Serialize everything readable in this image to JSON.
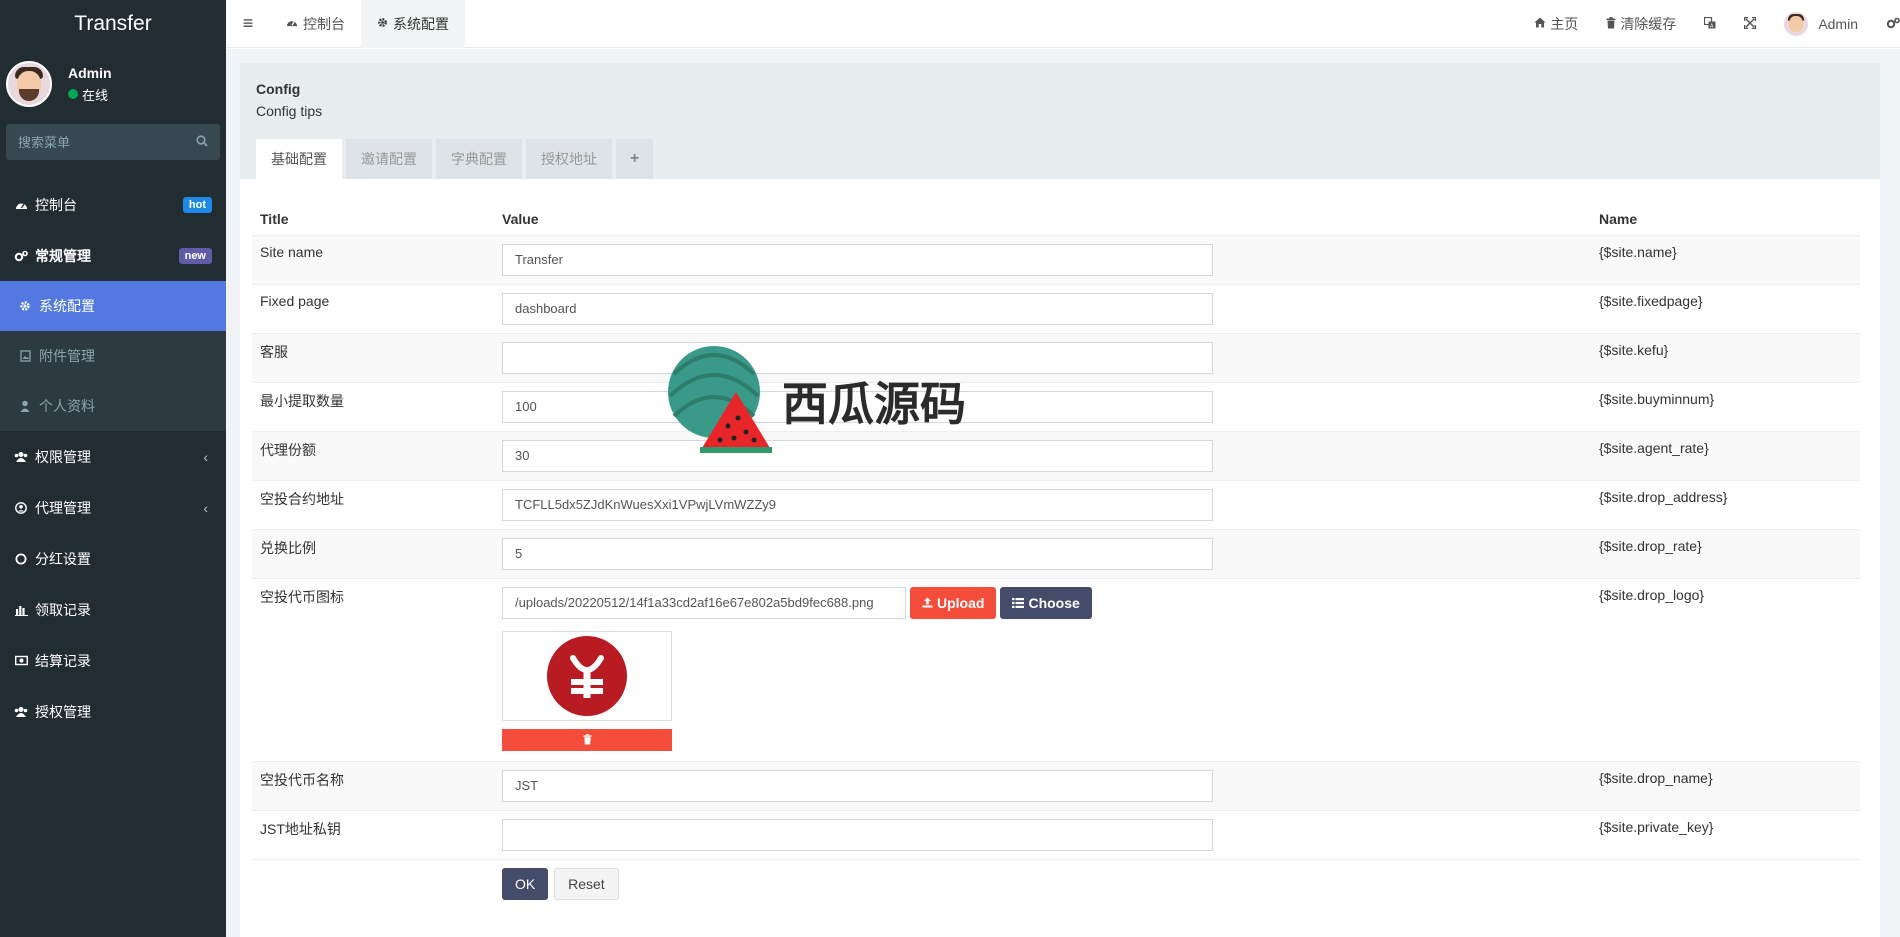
{
  "brand": "Transfer",
  "user": {
    "name": "Admin",
    "status": "在线"
  },
  "search": {
    "placeholder": "搜索菜单"
  },
  "sidebar": {
    "items": [
      {
        "label": "控制台",
        "icon": "dashboard-icon",
        "badge": "hot"
      },
      {
        "label": "常规管理",
        "icon": "cogs-icon",
        "badge": "new"
      },
      {
        "label": "系统配置",
        "icon": "gear-icon"
      },
      {
        "label": "附件管理",
        "icon": "file-image-icon"
      },
      {
        "label": "个人资料",
        "icon": "user-icon"
      },
      {
        "label": "权限管理",
        "icon": "group-icon"
      },
      {
        "label": "代理管理",
        "icon": "user-circle-icon"
      },
      {
        "label": "分红设置",
        "icon": "circle-icon"
      },
      {
        "label": "领取记录",
        "icon": "chart-icon"
      },
      {
        "label": "结算记录",
        "icon": "money-icon"
      },
      {
        "label": "授权管理",
        "icon": "group-icon"
      }
    ]
  },
  "header": {
    "tabs": [
      {
        "label": "控制台",
        "icon": "dashboard-icon"
      },
      {
        "label": "系统配置",
        "icon": "gear-icon"
      }
    ],
    "home": "主页",
    "clear_cache": "清除缓存",
    "user": "Admin"
  },
  "panel": {
    "title": "Config",
    "tips": "Config tips",
    "tabs": [
      "基础配置",
      "邀请配置",
      "字典配置",
      "授权地址"
    ]
  },
  "table": {
    "headers": {
      "title": "Title",
      "value": "Value",
      "name": "Name"
    },
    "rows": [
      {
        "title": "Site name",
        "value": "Transfer",
        "name": "{$site.name}"
      },
      {
        "title": "Fixed page",
        "value": "dashboard",
        "name": "{$site.fixedpage}"
      },
      {
        "title": "客服",
        "value": "",
        "name": "{$site.kefu}"
      },
      {
        "title": "最小提取数量",
        "value": "100",
        "name": "{$site.buyminnum}"
      },
      {
        "title": "代理份额",
        "value": "30",
        "name": "{$site.agent_rate}"
      },
      {
        "title": "空投合约地址",
        "value": "TCFLL5dx5ZJdKnWuesXxi1VPwjLVmWZZy9",
        "name": "{$site.drop_address}"
      },
      {
        "title": "兑换比例",
        "value": "5",
        "name": "{$site.drop_rate}"
      },
      {
        "title": "空投代币图标",
        "value": "/uploads/20220512/14f1a33cd2af16e67e802a5bd9fec688.png",
        "name": "{$site.drop_logo}"
      },
      {
        "title": "空投代币名称",
        "value": "JST",
        "name": "{$site.drop_name}"
      },
      {
        "title": "JST地址私钥",
        "value": "",
        "name": "{$site.private_key}"
      }
    ],
    "upload_label": "Upload",
    "choose_label": "Choose"
  },
  "buttons": {
    "ok": "OK",
    "reset": "Reset"
  },
  "watermark": "西瓜源码",
  "colors": {
    "sidebar_bg": "#222d32",
    "active_item": "#5378e0",
    "upload": "#f44d3b",
    "choose": "#444c69",
    "logo_red": "#b81c22"
  }
}
